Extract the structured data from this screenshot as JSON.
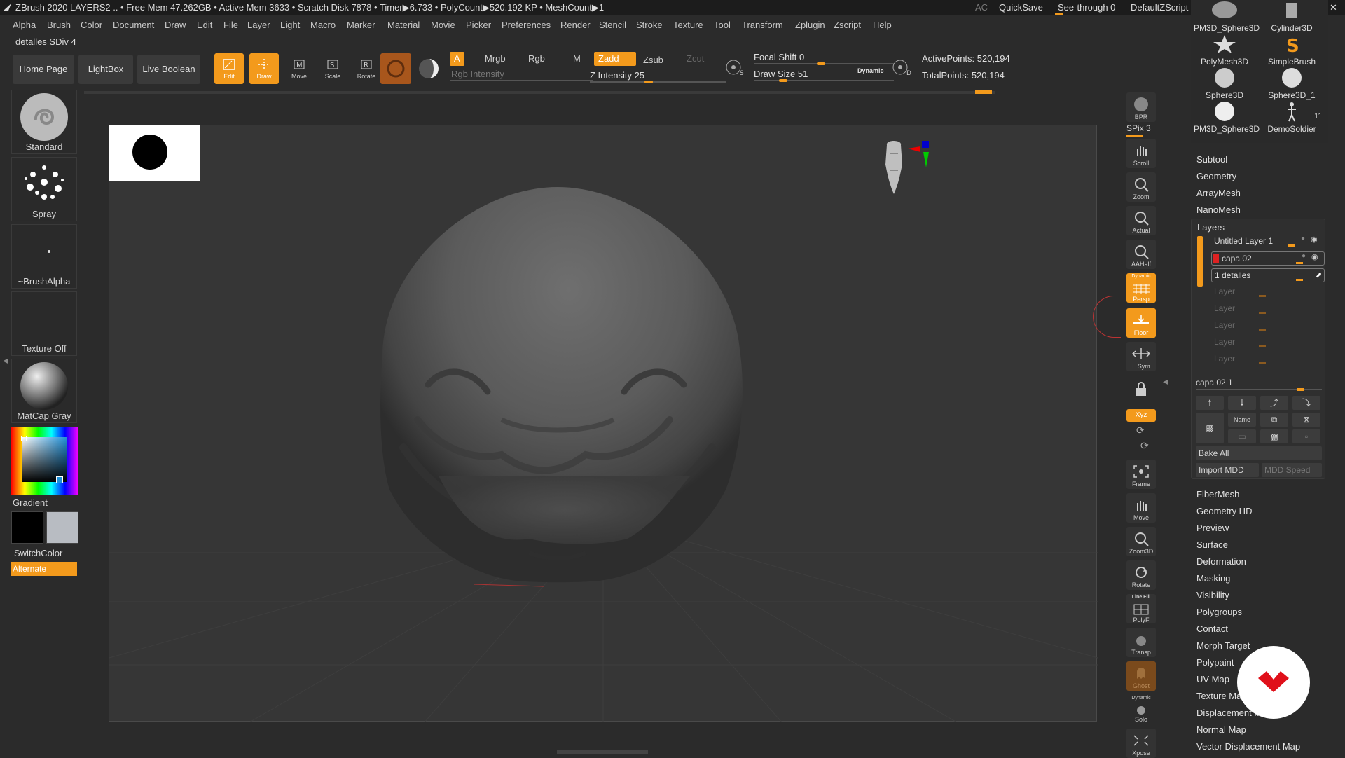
{
  "titlebar": {
    "title": "ZBrush 2020    LAYERS2   .. • Free Mem 47.262GB • Active Mem 3633 • Scratch Disk 7878 •  Timer▶6.733 • PolyCount▶520.192 KP  • MeshCount▶1",
    "ac": "AC",
    "quicksave": "QuickSave",
    "seethrough": "See-through   0",
    "script": "DefaultZScript"
  },
  "menu": [
    "Alpha",
    "Brush",
    "Color",
    "Document",
    "Draw",
    "Edit",
    "File",
    "Layer",
    "Light",
    "Macro",
    "Marker",
    "Material",
    "Movie",
    "Picker",
    "Preferences",
    "Render",
    "Stencil",
    "Stroke",
    "Texture",
    "Tool",
    "Transform",
    "Zplugin",
    "Zscript",
    "Help"
  ],
  "subtitle": "detalles SDiv 4",
  "shelf": {
    "home": "Home Page",
    "lightbox": "LightBox",
    "liveboolean": "Live Boolean",
    "edit": "Edit",
    "draw": "Draw",
    "move": "Move",
    "scale": "Scale",
    "rotate": "Rotate",
    "a": "A",
    "mrgb": "Mrgb",
    "rgb": "Rgb",
    "m": "M",
    "zadd": "Zadd",
    "zsub": "Zsub",
    "zcut": "Zcut",
    "rgb_intensity": "Rgb Intensity",
    "z_intensity": "Z Intensity 25",
    "focal_shift": "Focal Shift 0",
    "draw_size": "Draw Size 51",
    "dynamic": "Dynamic",
    "active_points": "ActivePoints: 520,194",
    "total_points": "TotalPoints: 520,194"
  },
  "left": {
    "standard": "Standard",
    "spray": "Spray",
    "brushalpha": "~BrushAlpha",
    "texture": "Texture Off",
    "matcap": "MatCap Gray",
    "gradient": "Gradient",
    "switchcolor": "SwitchColor",
    "alternate": "Alternate"
  },
  "right_strip": [
    "BPR",
    "SPix 3",
    "Scroll",
    "Zoom",
    "Actual",
    "AAHalf",
    "Persp",
    "Floor",
    "L.Sym",
    "",
    "Xyz",
    "",
    "",
    "Frame",
    "Move",
    "Zoom3D",
    "Rotate",
    "PolyF",
    "Transp",
    "Ghost",
    "Solo",
    "Xpose"
  ],
  "right_strip_extra": {
    "dynamic": "Dynamic",
    "linefill": "Line Fill"
  },
  "tools": [
    {
      "name": "PM3D_Sphere3D"
    },
    {
      "name": "Cylinder3D"
    },
    {
      "name": "PolyMesh3D"
    },
    {
      "name": "SimpleBrush"
    },
    {
      "name": "Sphere3D"
    },
    {
      "name": "Sphere3D_1"
    },
    {
      "name": "PM3D_Sphere3D"
    },
    {
      "name": "DemoSoldier"
    }
  ],
  "tool_count": "11",
  "toolpanel": {
    "subtool": "Subtool",
    "geometry": "Geometry",
    "arraymesh": "ArrayMesh",
    "nanomesh": "NanoMesh",
    "layers": "Layers",
    "layer_list": [
      "Untitled Layer 1",
      "capa 02",
      "1 detalles",
      "Layer",
      "Layer",
      "Layer",
      "Layer",
      "Layer"
    ],
    "current_layer": "capa 02 1",
    "name_btn": "Name",
    "bake_all": "Bake All",
    "import_mdd": "Import MDD",
    "mdd_speed": "MDD Speed",
    "sections": [
      "FiberMesh",
      "Geometry HD",
      "Preview",
      "Surface",
      "Deformation",
      "Masking",
      "Visibility",
      "Polygroups",
      "Contact",
      "Morph Target",
      "Polypaint",
      "UV Map",
      "Texture Map",
      "Displacement Map",
      "Normal Map",
      "Vector Displacement Map"
    ]
  },
  "colors": {
    "accent": "#f39a1c",
    "bg": "#2b2b2b",
    "viewport": "#363636"
  }
}
